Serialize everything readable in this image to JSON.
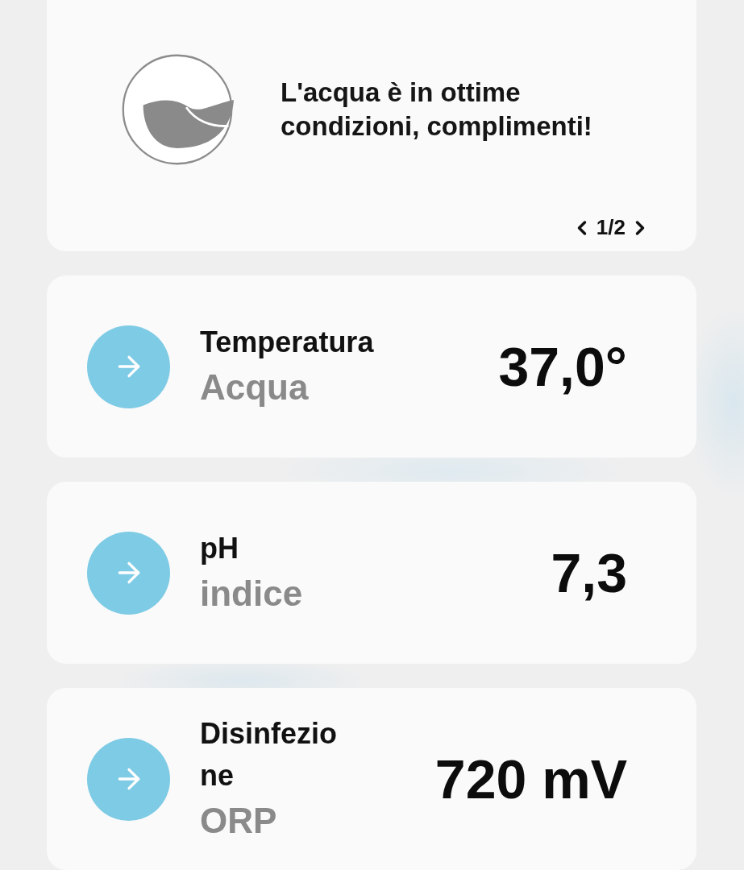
{
  "status": {
    "message": "L'acqua è in ottime condizioni, complimenti!",
    "page": "1/2"
  },
  "readings": [
    {
      "title": "Temperatura",
      "subtitle": "Acqua",
      "value": "37,0°"
    },
    {
      "title": "pH",
      "subtitle": "indice",
      "value": "7,3"
    },
    {
      "title": "Disinfezione",
      "subtitle": "ORP",
      "value": "720 mV"
    }
  ]
}
